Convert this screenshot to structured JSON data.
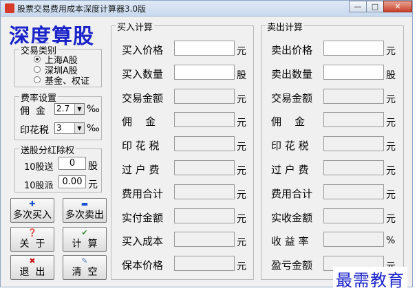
{
  "window": {
    "title": "股票交易费用成本深度计算器3.0版",
    "controls": {
      "minimize": "—",
      "maximize": "□",
      "close": "✕"
    }
  },
  "brand": "深度算股",
  "trade_type": {
    "caption": "交易类别",
    "options": [
      "上海A股",
      "深圳A股",
      "基金、权证"
    ],
    "selected": 0
  },
  "rates": {
    "caption": "费率设置",
    "commission_label": "佣  金",
    "commission_value": "2.7",
    "stamp_tax_label": "印花税",
    "stamp_tax_value": "3",
    "unit": "‰"
  },
  "dividend": {
    "caption": "送股分红除权",
    "bonus_label": "10股送",
    "bonus_value": "0",
    "bonus_unit": "股",
    "cash_label": "10股派",
    "cash_value": "0.00",
    "cash_unit": "元"
  },
  "buttons": {
    "multi_buy": "多次买入",
    "multi_sell": "多次卖出",
    "about": "关  于",
    "calculate": "计  算",
    "exit": "退  出",
    "clear": "清  空"
  },
  "buy": {
    "caption": "买入计算",
    "rows": [
      {
        "label": "买入价格",
        "unit": "元"
      },
      {
        "label": "买入数量",
        "unit": "股"
      },
      {
        "label": "交易金额",
        "unit": "元"
      },
      {
        "label": "佣    金",
        "unit": "元"
      },
      {
        "label": "印 花 税",
        "unit": "元"
      },
      {
        "label": "过 户 费",
        "unit": "元"
      },
      {
        "label": "费用合计",
        "unit": "元"
      },
      {
        "label": "实付金额",
        "unit": "元"
      },
      {
        "label": "买入成本",
        "unit": "元"
      },
      {
        "label": "保本价格",
        "unit": "元"
      }
    ]
  },
  "sell": {
    "caption": "卖出计算",
    "rows": [
      {
        "label": "卖出价格",
        "unit": "元"
      },
      {
        "label": "卖出数量",
        "unit": "股"
      },
      {
        "label": "交易金额",
        "unit": "元"
      },
      {
        "label": "佣    金",
        "unit": "元"
      },
      {
        "label": "印 花 税",
        "unit": "元"
      },
      {
        "label": "过 户 费",
        "unit": "元"
      },
      {
        "label": "费用合计",
        "unit": "元"
      },
      {
        "label": "实收金额",
        "unit": "元"
      },
      {
        "label": "收 益 率",
        "unit": "%"
      },
      {
        "label": "盈亏金额",
        "unit": "元"
      }
    ]
  },
  "watermark": "最需教育",
  "colors": {
    "brand": "#1a23c9",
    "window_bg": "#f0f0f0"
  }
}
